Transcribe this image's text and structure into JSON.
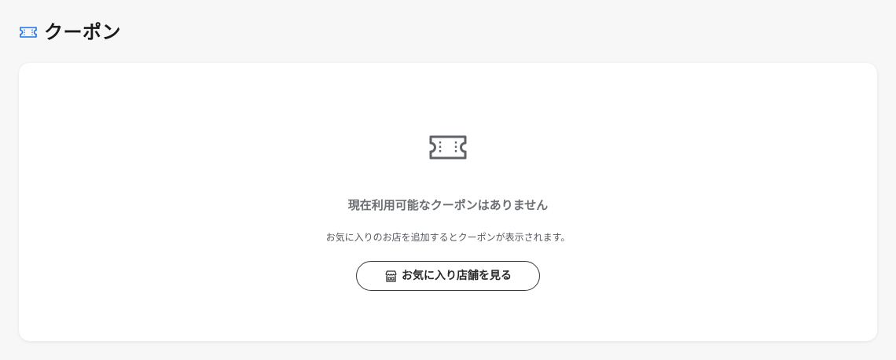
{
  "header": {
    "icon": "ticket-icon",
    "title": "クーポン"
  },
  "empty_state": {
    "icon": "ticket-icon",
    "title": "現在利用可能なクーポンはありません",
    "description": "お気に入りのお店を追加するとクーポンが表示されます。",
    "button": {
      "icon": "store-icon",
      "label": "お気に入り店舗を見る"
    }
  },
  "colors": {
    "accent_blue": "#1a73e8",
    "muted_gray": "#6b6f74",
    "card_background": "#ffffff",
    "page_background": "#f7f7f7"
  }
}
